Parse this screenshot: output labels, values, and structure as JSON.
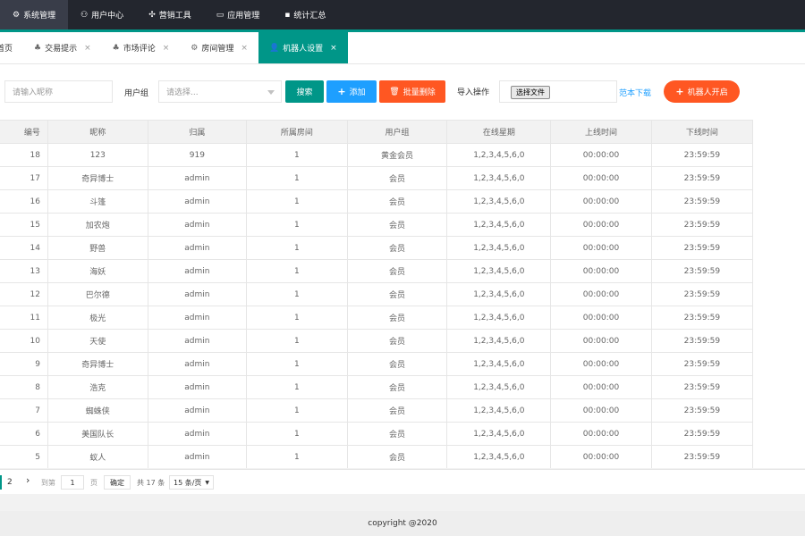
{
  "topnav": {
    "items": [
      {
        "label": "系统管理",
        "icon": "gear-icon",
        "glyph": "⚙"
      },
      {
        "label": "用户中心",
        "icon": "user-icon",
        "glyph": "⚇"
      },
      {
        "label": "营销工具",
        "icon": "tools-icon",
        "glyph": "✣"
      },
      {
        "label": "应用管理",
        "icon": "app-icon",
        "glyph": "▭"
      },
      {
        "label": "统计汇总",
        "icon": "chat-icon",
        "glyph": "▪"
      }
    ]
  },
  "tabs": {
    "items": [
      {
        "label": "首页",
        "glyph": ""
      },
      {
        "label": "交易提示",
        "glyph": "♣",
        "close": "×"
      },
      {
        "label": "市场评论",
        "glyph": "♣",
        "close": "×"
      },
      {
        "label": "房间管理",
        "glyph": "⚙",
        "close": "×"
      },
      {
        "label": "机器人设置",
        "glyph": "👤",
        "close": "×"
      }
    ]
  },
  "toolbar": {
    "nickname_placeholder": "请输入昵称",
    "group_label": "用户组",
    "group_placeholder": "请选择...",
    "search_label": "搜索",
    "add_label": "添加",
    "batch_delete_label": "批量删除",
    "import_label": "导入操作",
    "choose_file_label": "选择文件",
    "template_download_label": "范本下载",
    "robot_start_label": "机器人开启",
    "colors": {
      "teal": "#009688",
      "blue": "#1e9fff",
      "orange": "#ff5722"
    }
  },
  "table": {
    "headers": [
      "编号",
      "昵称",
      "归属",
      "所属房间",
      "用户组",
      "在线星期",
      "上线时间",
      "下线时间"
    ],
    "rows": [
      [
        "18",
        "123",
        "919",
        "1",
        "黄金会员",
        "1,2,3,4,5,6,0",
        "00:00:00",
        "23:59:59"
      ],
      [
        "17",
        "奇异博士",
        "admin",
        "1",
        "会员",
        "1,2,3,4,5,6,0",
        "00:00:00",
        "23:59:59"
      ],
      [
        "16",
        "斗篷",
        "admin",
        "1",
        "会员",
        "1,2,3,4,5,6,0",
        "00:00:00",
        "23:59:59"
      ],
      [
        "15",
        "加农炮",
        "admin",
        "1",
        "会员",
        "1,2,3,4,5,6,0",
        "00:00:00",
        "23:59:59"
      ],
      [
        "14",
        "野兽",
        "admin",
        "1",
        "会员",
        "1,2,3,4,5,6,0",
        "00:00:00",
        "23:59:59"
      ],
      [
        "13",
        "海妖",
        "admin",
        "1",
        "会员",
        "1,2,3,4,5,6,0",
        "00:00:00",
        "23:59:59"
      ],
      [
        "12",
        "巴尔德",
        "admin",
        "1",
        "会员",
        "1,2,3,4,5,6,0",
        "00:00:00",
        "23:59:59"
      ],
      [
        "11",
        "极光",
        "admin",
        "1",
        "会员",
        "1,2,3,4,5,6,0",
        "00:00:00",
        "23:59:59"
      ],
      [
        "10",
        "天使",
        "admin",
        "1",
        "会员",
        "1,2,3,4,5,6,0",
        "00:00:00",
        "23:59:59"
      ],
      [
        "9",
        "奇异博士",
        "admin",
        "1",
        "会员",
        "1,2,3,4,5,6,0",
        "00:00:00",
        "23:59:59"
      ],
      [
        "8",
        "浩克",
        "admin",
        "1",
        "会员",
        "1,2,3,4,5,6,0",
        "00:00:00",
        "23:59:59"
      ],
      [
        "7",
        "蜘蛛侠",
        "admin",
        "1",
        "会员",
        "1,2,3,4,5,6,0",
        "00:00:00",
        "23:59:59"
      ],
      [
        "6",
        "美国队长",
        "admin",
        "1",
        "会员",
        "1,2,3,4,5,6,0",
        "00:00:00",
        "23:59:59"
      ],
      [
        "5",
        "蚁人",
        "admin",
        "1",
        "会员",
        "1,2,3,4,5,6,0",
        "00:00:00",
        "23:59:59"
      ]
    ]
  },
  "pager": {
    "page2": "2",
    "goto_label": "到第",
    "page_input": "1",
    "page_unit": "页",
    "confirm_label": "确定",
    "total_label": "共 17 条",
    "per_page": "15 条/页"
  },
  "footer": {
    "text": "copyright @2020"
  }
}
